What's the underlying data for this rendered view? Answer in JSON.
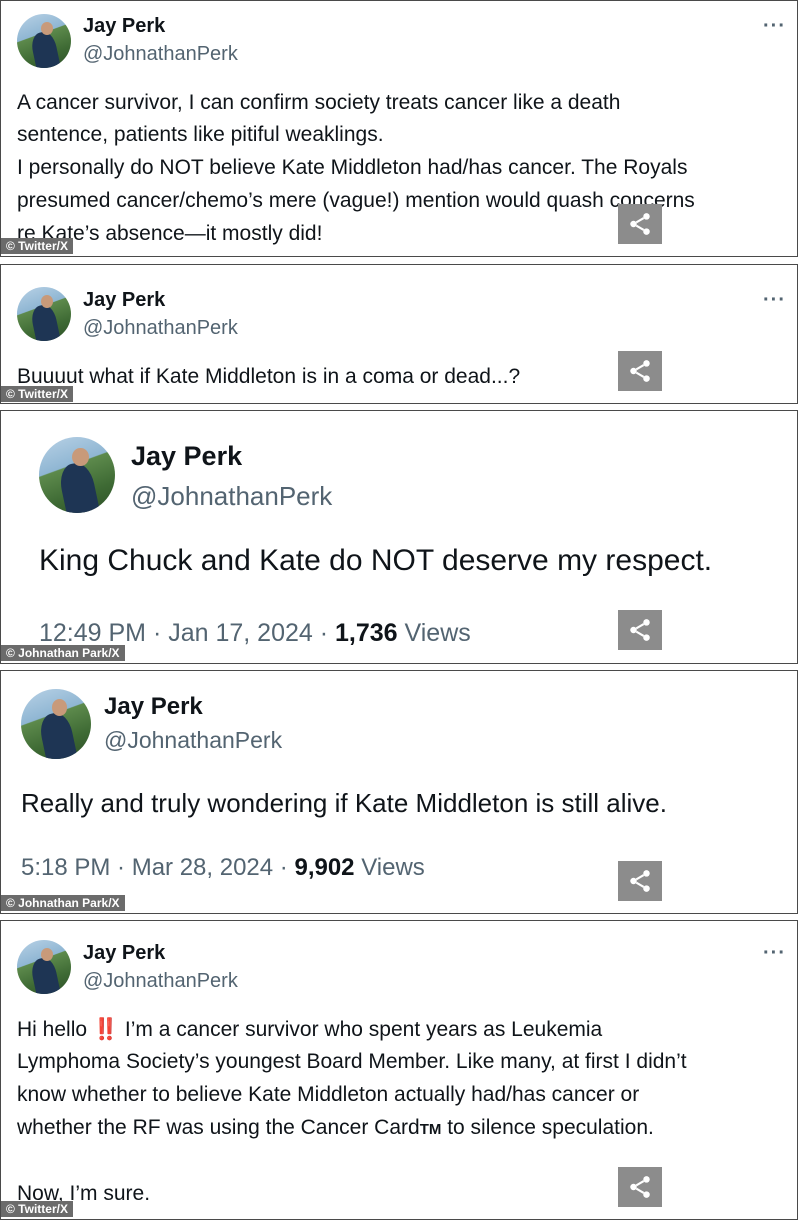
{
  "tweets": [
    {
      "name": "Jay Perk",
      "handle": "@JohnathanPerk",
      "more": "···",
      "lines": [
        "A cancer survivor, I can confirm society treats cancer like a death",
        "sentence, patients like pitiful weaklings.",
        "I personally do NOT believe Kate Middleton had/has cancer. The Royals",
        "presumed cancer/chemo’s mere (vague!) mention would quash concerns",
        "re Kate’s absence—it mostly did!"
      ],
      "credit": "© Twitter/X"
    },
    {
      "name": "Jay Perk",
      "handle": "@JohnathanPerk",
      "more": "···",
      "lines": [
        "Buuuut what if Kate Middleton is in a coma or dead...?"
      ],
      "credit": "© Twitter/X"
    },
    {
      "name": "Jay Perk",
      "handle": "@JohnathanPerk",
      "lines": [
        "King Chuck and Kate do NOT deserve my respect."
      ],
      "time": "12:49 PM · Jan 17, 2024 · ",
      "views_count": "1,736",
      "views_label": " Views",
      "credit": "© Johnathan Park/X"
    },
    {
      "name": "Jay Perk",
      "handle": "@JohnathanPerk",
      "lines": [
        "Really and truly wondering if Kate Middleton is still alive."
      ],
      "time": "5:18 PM · Mar 28, 2024 · ",
      "views_count": "9,902",
      "views_label": " Views",
      "credit": "© Johnathan Park/X"
    },
    {
      "name": "Jay Perk",
      "handle": "@JohnathanPerk",
      "more": "···",
      "line1_a": "Hi hello ",
      "line1_bang": "‼️",
      "line1_b": " I’m a cancer survivor who spent years as Leukemia",
      "line2": "Lymphoma Society’s youngest Board Member. Like many, at first I didn’t",
      "line3": "know whether to believe Kate Middleton actually had/has cancer or",
      "line4_a": "whether the RF was using the Cancer Card",
      "line4_tm": "TM",
      "line4_b": " to silence speculation.",
      "line5": "Now, I’m sure.",
      "credit": "© Twitter/X"
    }
  ],
  "icons": {
    "share": "share-icon",
    "more": "more-options-icon",
    "avatar": "profile-photo"
  }
}
